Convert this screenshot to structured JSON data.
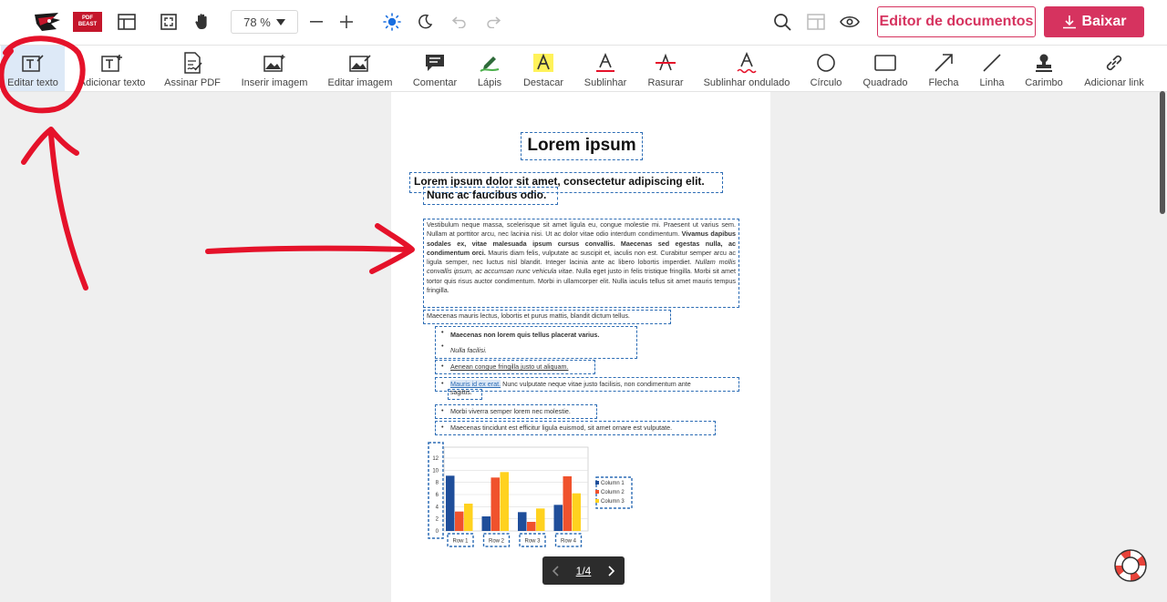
{
  "topbar": {
    "logo_text": "PDF BEAST",
    "zoom": "78 %",
    "editor_button": "Editor de documentos",
    "download_button": "Baixar"
  },
  "tools": [
    {
      "label": "Editar texto",
      "icon": "edit-text-icon"
    },
    {
      "label": "Adicionar texto",
      "icon": "add-text-icon"
    },
    {
      "label": "Assinar PDF",
      "icon": "sign-icon"
    },
    {
      "label": "Inserir imagem",
      "icon": "insert-image-icon"
    },
    {
      "label": "Editar imagem",
      "icon": "edit-image-icon"
    },
    {
      "label": "Comentar",
      "icon": "comment-icon"
    },
    {
      "label": "Lápis",
      "icon": "pencil-icon"
    },
    {
      "label": "Destacar",
      "icon": "highlight-icon"
    },
    {
      "label": "Sublinhar",
      "icon": "underline-icon"
    },
    {
      "label": "Rasurar",
      "icon": "strikethrough-icon"
    },
    {
      "label": "Sublinhar ondulado",
      "icon": "wavy-underline-icon"
    },
    {
      "label": "Círculo",
      "icon": "circle-icon"
    },
    {
      "label": "Quadrado",
      "icon": "square-icon"
    },
    {
      "label": "Flecha",
      "icon": "arrow-icon"
    },
    {
      "label": "Linha",
      "icon": "line-icon"
    },
    {
      "label": "Carimbo",
      "icon": "stamp-icon"
    },
    {
      "label": "Adicionar link",
      "icon": "link-icon"
    }
  ],
  "doc": {
    "title": "Lorem ipsum",
    "subtitle_1": "Lorem ipsum dolor sit amet, consectetur adipiscing elit.",
    "subtitle_2": "Nunc ac faucibus odio.",
    "para_a": "Vestibulum neque massa, scelerisque sit amet ligula eu, congue molestie mi. Praesent ut varius sem. Nullam at porttitor arcu, nec lacinia nisi. Ut ac dolor vitae odio interdum condimentum. ",
    "para_b": "Vivamus dapibus sodales ex, vitae malesuada ipsum cursus convallis. Maecenas sed egestas nulla, ac condimentum orci.",
    "para_c": " Mauris diam felis, vulputate ac suscipit et, iaculis non est. Curabitur semper arcu ac ligula semper, nec luctus nisl blandit. Integer lacinia ante ac libero lobortis imperdiet. ",
    "para_d": "Nullam mollis convallis ipsum, ac accumsan nunc vehicula vitae.",
    "para_e": " Nulla eget justo in felis tristique fringilla. Morbi sit amet tortor quis risus auctor condimentum. Morbi in ullamcorper elit. Nulla iaculis tellus sit amet mauris tempus fringilla.",
    "line_1": "Maecenas mauris lectus, lobortis et purus mattis, blandit dictum tellus.",
    "bullet_1": "Maecenas non lorem quis tellus placerat varius.",
    "bullet_2": "Nulla facilisi.",
    "bullet_3": "Aenean congue fringilla justo ut aliquam.",
    "bullet_4a": "Mauris id ex erat.",
    "bullet_4b": " Nunc vulputate neque vitae justo facilisis, non condimentum ante",
    "bullet_4c": "sagittis.",
    "bullet_5": "Morbi viverra semper lorem nec molestie.",
    "bullet_6": "Maecenas tincidunt est efficitur ligula euismod, sit amet ornare est vulputate."
  },
  "pager": {
    "text": "1/4"
  },
  "chart_data": {
    "type": "bar",
    "categories": [
      "Row 1",
      "Row 2",
      "Row 3",
      "Row 4"
    ],
    "series": [
      {
        "name": "Column 1",
        "values": [
          9.1,
          2.4,
          3.1,
          4.3
        ],
        "color": "#1f4e9a"
      },
      {
        "name": "Column 2",
        "values": [
          3.2,
          8.8,
          1.5,
          9.0
        ],
        "color": "#f0522d"
      },
      {
        "name": "Column 3",
        "values": [
          4.5,
          9.7,
          3.7,
          6.2
        ],
        "color": "#ffd21f"
      }
    ],
    "ylim": [
      0,
      12
    ],
    "yticks": [
      "0",
      "2",
      "4",
      "6",
      "8",
      "10",
      "12"
    ],
    "legend": "right",
    "grid": true
  },
  "colors": {
    "accent": "#d6335f",
    "selection": "#2d6db5",
    "annotation": "#e5122a"
  }
}
